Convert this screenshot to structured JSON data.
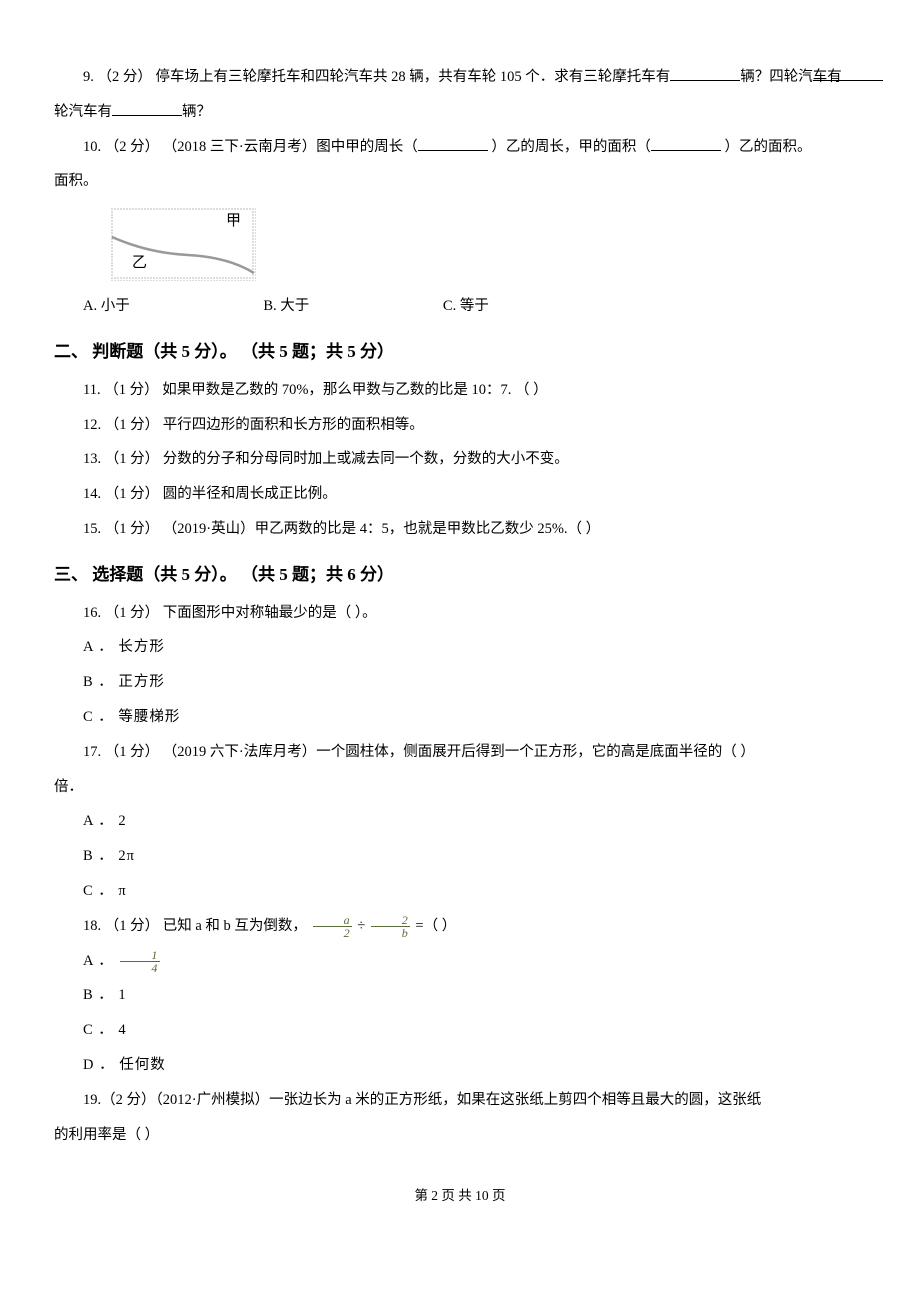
{
  "q9": {
    "text_a": "9. （2 分） 停车场上有三轮摩托车和四轮汽车共 28 辆，共有车轮 105 个．求有三轮摩托车有",
    "text_b": "辆？四轮汽车有",
    "text_c": "辆？"
  },
  "q10": {
    "text_a": "10. （2 分） （2018 三下·云南月考）图中甲的周长（",
    "text_b": "  ）乙的周长，甲的面积（",
    "text_c": "  ）乙的面积。",
    "fig_label_a": "甲",
    "fig_label_b": "乙",
    "opt_a": "A. 小于",
    "opt_b": "B. 大于",
    "opt_c": "C. 等于"
  },
  "section2": "二、 判断题（共 5 分）。 （共 5 题；共 5 分）",
  "q11": "11. （1 分） 如果甲数是乙数的 70%，那么甲数与乙数的比是 10：7.  （     ）",
  "q12": "12. （1 分） 平行四边形的面积和长方形的面积相等。",
  "q13": "13. （1 分） 分数的分子和分母同时加上或减去同一个数，分数的大小不变。",
  "q14": "14. （1 分） 圆的半径和周长成正比例。",
  "q15": "15. （1 分） （2019·英山）甲乙两数的比是 4：5，也就是甲数比乙数少 25%.（     ）",
  "section3": "三、 选择题（共 5 分）。 （共 5 题；共 6 分）",
  "q16": {
    "stem": "16. （1 分） 下面图形中对称轴最少的是（     ）。",
    "a": "A ． 长方形",
    "b": "B ． 正方形",
    "c": "C ． 等腰梯形"
  },
  "q17": {
    "stem_a": "17. （1 分） （2019 六下·法库月考）一个圆柱体，侧面展开后得到一个正方形，它的高是底面半径的（     ）",
    "stem_b": "倍．",
    "a": "A ． 2",
    "b": "B ． 2π",
    "c": "C ． π"
  },
  "q18": {
    "stem_a": "18. （1 分） 已知 a 和 b 互为倒数， ",
    "frac1_num": "a",
    "frac1_den": "2",
    "div": " ÷ ",
    "frac2_num": "2",
    "frac2_den": "b",
    "stem_b": " =（     ）",
    "a_pre": "A ． ",
    "a_num": "1",
    "a_den": "4",
    "b": "B ． 1",
    "c": "C ． 4",
    "d": "D ． 任何数"
  },
  "q19": {
    "stem_a": "19.（2 分）（2012·广州模拟）一张边长为 a 米的正方形纸，如果在这张纸上剪四个相等且最大的圆，这张纸",
    "stem_b": "的利用率是（     ）"
  },
  "footer": "第 2 页 共 10 页"
}
